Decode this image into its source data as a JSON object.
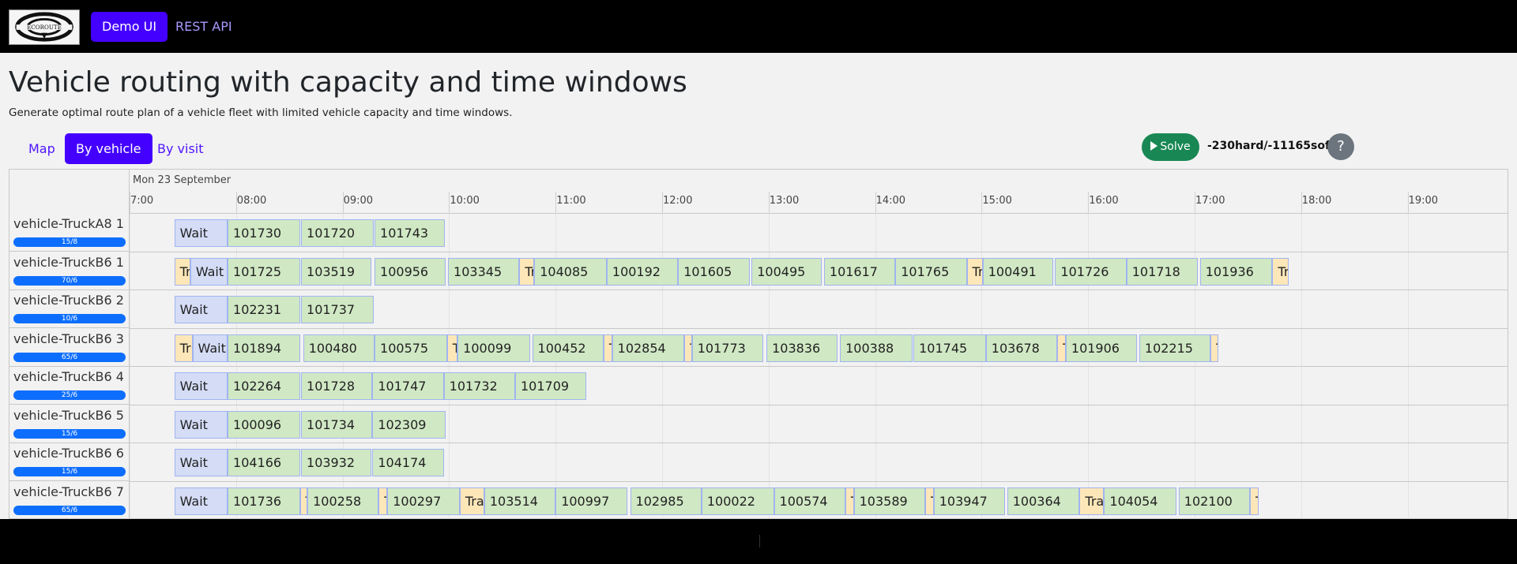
{
  "header": {
    "logo_text": "ECOROUTE",
    "nav": [
      {
        "label": "Demo UI",
        "active": true
      },
      {
        "label": "REST API",
        "active": false
      }
    ]
  },
  "page": {
    "title": "Vehicle routing with capacity and time windows",
    "subtitle": "Generate optimal route plan of a vehicle fleet with limited vehicle capacity and time windows."
  },
  "tabs": [
    {
      "label": "Map",
      "active": false
    },
    {
      "label": "By vehicle",
      "active": true
    },
    {
      "label": "By visit",
      "active": false
    }
  ],
  "toolbar": {
    "solve_label": "Solve",
    "score": "-230hard/-11165soft",
    "help_label": "?"
  },
  "timeline": {
    "date": "Mon 23 September",
    "hours": [
      "7:00",
      "08:00",
      "09:00",
      "10:00",
      "11:00",
      "12:00",
      "13:00",
      "14:00",
      "15:00",
      "16:00",
      "17:00",
      "18:00",
      "19:00"
    ],
    "start_hour": 7.0,
    "vehicles": [
      {
        "name": "vehicle-TruckA8 1",
        "capacity": "15/8",
        "items": [
          {
            "type": "wait",
            "label": "Wait",
            "start": 7.42,
            "end": 7.92
          },
          {
            "type": "visit",
            "label": "101730",
            "start": 7.92,
            "end": 8.6
          },
          {
            "type": "visit",
            "label": "101720",
            "start": 8.61,
            "end": 9.29
          },
          {
            "type": "visit",
            "label": "101743",
            "start": 9.3,
            "end": 9.96
          }
        ]
      },
      {
        "name": "vehicle-TruckB6 1",
        "capacity": "70/6",
        "items": [
          {
            "type": "travel",
            "label": "Tr",
            "start": 7.42,
            "end": 7.57
          },
          {
            "type": "wait",
            "label": "Wait",
            "start": 7.57,
            "end": 7.92
          },
          {
            "type": "visit",
            "label": "101725",
            "start": 7.92,
            "end": 8.6
          },
          {
            "type": "visit",
            "label": "103519",
            "start": 8.61,
            "end": 9.27
          },
          {
            "type": "visit",
            "label": "100956",
            "start": 9.3,
            "end": 9.97
          },
          {
            "type": "visit",
            "label": "103345",
            "start": 9.99,
            "end": 10.66
          },
          {
            "type": "travel",
            "label": "Tr",
            "start": 10.66,
            "end": 10.8
          },
          {
            "type": "visit",
            "label": "104085",
            "start": 10.8,
            "end": 11.48
          },
          {
            "type": "visit",
            "label": "100192",
            "start": 11.48,
            "end": 12.15
          },
          {
            "type": "visit",
            "label": "101605",
            "start": 12.15,
            "end": 12.82
          },
          {
            "type": "visit",
            "label": "100495",
            "start": 12.84,
            "end": 13.5
          },
          {
            "type": "visit",
            "label": "101617",
            "start": 13.52,
            "end": 14.19
          },
          {
            "type": "visit",
            "label": "101765",
            "start": 14.19,
            "end": 14.86
          },
          {
            "type": "travel",
            "label": "Tr",
            "start": 14.86,
            "end": 15.01
          },
          {
            "type": "visit",
            "label": "100491",
            "start": 15.01,
            "end": 15.67
          },
          {
            "type": "visit",
            "label": "101726",
            "start": 15.69,
            "end": 16.36
          },
          {
            "type": "visit",
            "label": "101718",
            "start": 16.36,
            "end": 17.03
          },
          {
            "type": "visit",
            "label": "101936",
            "start": 17.05,
            "end": 17.73
          },
          {
            "type": "travel",
            "label": "Tr",
            "start": 17.73,
            "end": 17.88
          }
        ]
      },
      {
        "name": "vehicle-TruckB6 2",
        "capacity": "10/6",
        "items": [
          {
            "type": "wait",
            "label": "Wait",
            "start": 7.42,
            "end": 7.92
          },
          {
            "type": "visit",
            "label": "102231",
            "start": 7.92,
            "end": 8.6
          },
          {
            "type": "visit",
            "label": "101737",
            "start": 8.61,
            "end": 9.29
          }
        ]
      },
      {
        "name": "vehicle-TruckB6 3",
        "capacity": "65/6",
        "items": [
          {
            "type": "travel",
            "label": "Tr",
            "start": 7.42,
            "end": 7.59
          },
          {
            "type": "wait",
            "label": "Wait",
            "start": 7.59,
            "end": 7.92
          },
          {
            "type": "visit",
            "label": "101894",
            "start": 7.92,
            "end": 8.6
          },
          {
            "type": "visit",
            "label": "100480",
            "start": 8.63,
            "end": 9.3
          },
          {
            "type": "visit",
            "label": "100575",
            "start": 9.3,
            "end": 9.98
          },
          {
            "type": "travel",
            "label": "T",
            "start": 9.98,
            "end": 10.08
          },
          {
            "type": "visit",
            "label": "100099",
            "start": 10.08,
            "end": 10.76
          },
          {
            "type": "visit",
            "label": "100452",
            "start": 10.78,
            "end": 11.45
          },
          {
            "type": "travel",
            "label": "T",
            "start": 11.45,
            "end": 11.53
          },
          {
            "type": "visit",
            "label": "102854",
            "start": 11.53,
            "end": 12.21
          },
          {
            "type": "travel",
            "label": "T",
            "start": 12.21,
            "end": 12.28
          },
          {
            "type": "visit",
            "label": "101773",
            "start": 12.28,
            "end": 12.95
          },
          {
            "type": "visit",
            "label": "103836",
            "start": 12.98,
            "end": 13.65
          },
          {
            "type": "visit",
            "label": "100388",
            "start": 13.67,
            "end": 14.35
          },
          {
            "type": "visit",
            "label": "101745",
            "start": 14.36,
            "end": 15.04
          },
          {
            "type": "visit",
            "label": "103678",
            "start": 15.04,
            "end": 15.71
          },
          {
            "type": "travel",
            "label": "T",
            "start": 15.71,
            "end": 15.79
          },
          {
            "type": "visit",
            "label": "101906",
            "start": 15.79,
            "end": 16.46
          },
          {
            "type": "visit",
            "label": "102215",
            "start": 16.48,
            "end": 17.15
          },
          {
            "type": "travel",
            "label": "T",
            "start": 17.15,
            "end": 17.22
          }
        ]
      },
      {
        "name": "vehicle-TruckB6 4",
        "capacity": "25/6",
        "items": [
          {
            "type": "wait",
            "label": "Wait",
            "start": 7.42,
            "end": 7.92
          },
          {
            "type": "visit",
            "label": "102264",
            "start": 7.92,
            "end": 8.6
          },
          {
            "type": "visit",
            "label": "101728",
            "start": 8.61,
            "end": 9.28
          },
          {
            "type": "visit",
            "label": "101747",
            "start": 9.28,
            "end": 9.95
          },
          {
            "type": "visit",
            "label": "101732",
            "start": 9.95,
            "end": 10.62
          },
          {
            "type": "visit",
            "label": "101709",
            "start": 10.62,
            "end": 11.29
          }
        ]
      },
      {
        "name": "vehicle-TruckB6 5",
        "capacity": "15/6",
        "items": [
          {
            "type": "wait",
            "label": "Wait",
            "start": 7.42,
            "end": 7.92
          },
          {
            "type": "visit",
            "label": "100096",
            "start": 7.92,
            "end": 8.6
          },
          {
            "type": "visit",
            "label": "101734",
            "start": 8.61,
            "end": 9.28
          },
          {
            "type": "visit",
            "label": "102309",
            "start": 9.28,
            "end": 9.97
          }
        ]
      },
      {
        "name": "vehicle-TruckB6 6",
        "capacity": "15/6",
        "items": [
          {
            "type": "wait",
            "label": "Wait",
            "start": 7.42,
            "end": 7.92
          },
          {
            "type": "visit",
            "label": "104166",
            "start": 7.92,
            "end": 8.6
          },
          {
            "type": "visit",
            "label": "103932",
            "start": 8.61,
            "end": 9.27
          },
          {
            "type": "visit",
            "label": "104174",
            "start": 9.28,
            "end": 9.95
          }
        ]
      },
      {
        "name": "vehicle-TruckB6 7",
        "capacity": "65/6",
        "items": [
          {
            "type": "wait",
            "label": "Wait",
            "start": 7.42,
            "end": 7.92
          },
          {
            "type": "visit",
            "label": "101736",
            "start": 7.92,
            "end": 8.6
          },
          {
            "type": "travel",
            "label": "T",
            "start": 8.6,
            "end": 8.67
          },
          {
            "type": "visit",
            "label": "100258",
            "start": 8.67,
            "end": 9.34
          },
          {
            "type": "travel",
            "label": "T",
            "start": 9.34,
            "end": 9.42
          },
          {
            "type": "visit",
            "label": "100297",
            "start": 9.42,
            "end": 10.1
          },
          {
            "type": "travel",
            "label": "Tra",
            "start": 10.1,
            "end": 10.33
          },
          {
            "type": "visit",
            "label": "103514",
            "start": 10.33,
            "end": 11.0
          },
          {
            "type": "visit",
            "label": "100997",
            "start": 11.0,
            "end": 11.67
          },
          {
            "type": "visit",
            "label": "102985",
            "start": 11.7,
            "end": 12.37
          },
          {
            "type": "visit",
            "label": "100022",
            "start": 12.37,
            "end": 13.05
          },
          {
            "type": "visit",
            "label": "100574",
            "start": 13.05,
            "end": 13.72
          },
          {
            "type": "travel",
            "label": "T",
            "start": 13.72,
            "end": 13.8
          },
          {
            "type": "visit",
            "label": "103589",
            "start": 13.8,
            "end": 14.47
          },
          {
            "type": "travel",
            "label": "T",
            "start": 14.47,
            "end": 14.55
          },
          {
            "type": "visit",
            "label": "103947",
            "start": 14.55,
            "end": 15.22
          },
          {
            "type": "visit",
            "label": "100364",
            "start": 15.24,
            "end": 15.92
          },
          {
            "type": "travel",
            "label": "Tra",
            "start": 15.92,
            "end": 16.15
          },
          {
            "type": "visit",
            "label": "104054",
            "start": 16.15,
            "end": 16.83
          },
          {
            "type": "visit",
            "label": "102100",
            "start": 16.85,
            "end": 17.52
          },
          {
            "type": "travel",
            "label": "T",
            "start": 17.52,
            "end": 17.6
          }
        ]
      }
    ]
  }
}
